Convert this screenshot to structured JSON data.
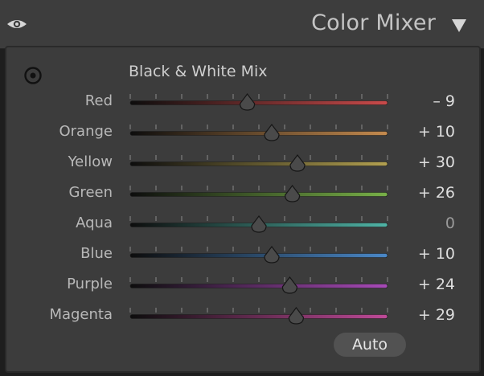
{
  "header": {
    "title": "Color Mixer"
  },
  "panel": {
    "section_title": "Black & White Mix",
    "auto_label": "Auto"
  },
  "slider_range": [
    -100,
    100
  ],
  "sliders": [
    {
      "label": "Red",
      "value": -9,
      "display": "– 9",
      "color": "#c94a4a"
    },
    {
      "label": "Orange",
      "value": 10,
      "display": "+ 10",
      "color": "#c48a4e"
    },
    {
      "label": "Yellow",
      "value": 30,
      "display": "+ 30",
      "color": "#b2a050"
    },
    {
      "label": "Green",
      "value": 26,
      "display": "+ 26",
      "color": "#78b048"
    },
    {
      "label": "Aqua",
      "value": 0,
      "display": "0",
      "color": "#4fb4a6"
    },
    {
      "label": "Blue",
      "value": 10,
      "display": "+ 10",
      "color": "#4a88c8"
    },
    {
      "label": "Purple",
      "value": 24,
      "display": "+ 24",
      "color": "#a84ab8"
    },
    {
      "label": "Magenta",
      "value": 29,
      "display": "+ 29",
      "color": "#bf4a98"
    }
  ],
  "icons": {
    "visibility": "eye-icon",
    "collapse": "triangle-down-icon",
    "target": "target-adjustment-icon"
  }
}
